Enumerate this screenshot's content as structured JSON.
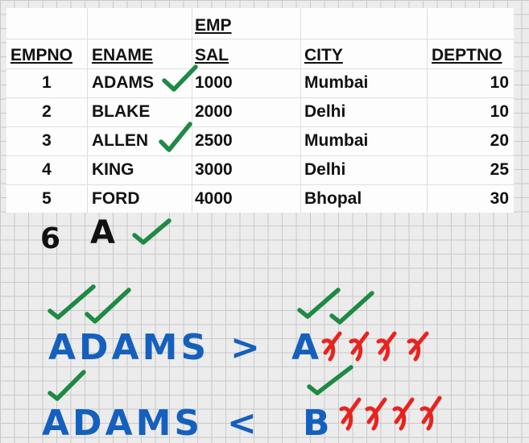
{
  "table": {
    "title": "EMP",
    "columns": [
      "EMPNO",
      "ENAME",
      "SAL",
      "CITY",
      "DEPTNO"
    ],
    "rows": [
      [
        "1",
        "ADAMS",
        "1000",
        "Mumbai",
        "10"
      ],
      [
        "2",
        "BLAKE",
        "2000",
        "Delhi",
        "10"
      ],
      [
        "3",
        "ALLEN",
        "2500",
        "Mumbai",
        "20"
      ],
      [
        "4",
        "KING",
        "3000",
        "Delhi",
        "25"
      ],
      [
        "5",
        "FORD",
        "4000",
        "Bhopal",
        "30"
      ]
    ]
  },
  "annotations": {
    "row6_number": "6",
    "row6_letter": "A",
    "compare1_left": "ADAMS",
    "compare1_op": ">",
    "compare1_right": "A",
    "compare2_left": "ADAMS",
    "compare2_op": "<",
    "compare2_right": "B"
  },
  "colors": {
    "check": "#1e8a44",
    "handwriting_blue": "#1560bd",
    "strike_red": "#e8231f",
    "handwriting_black": "#111111"
  }
}
